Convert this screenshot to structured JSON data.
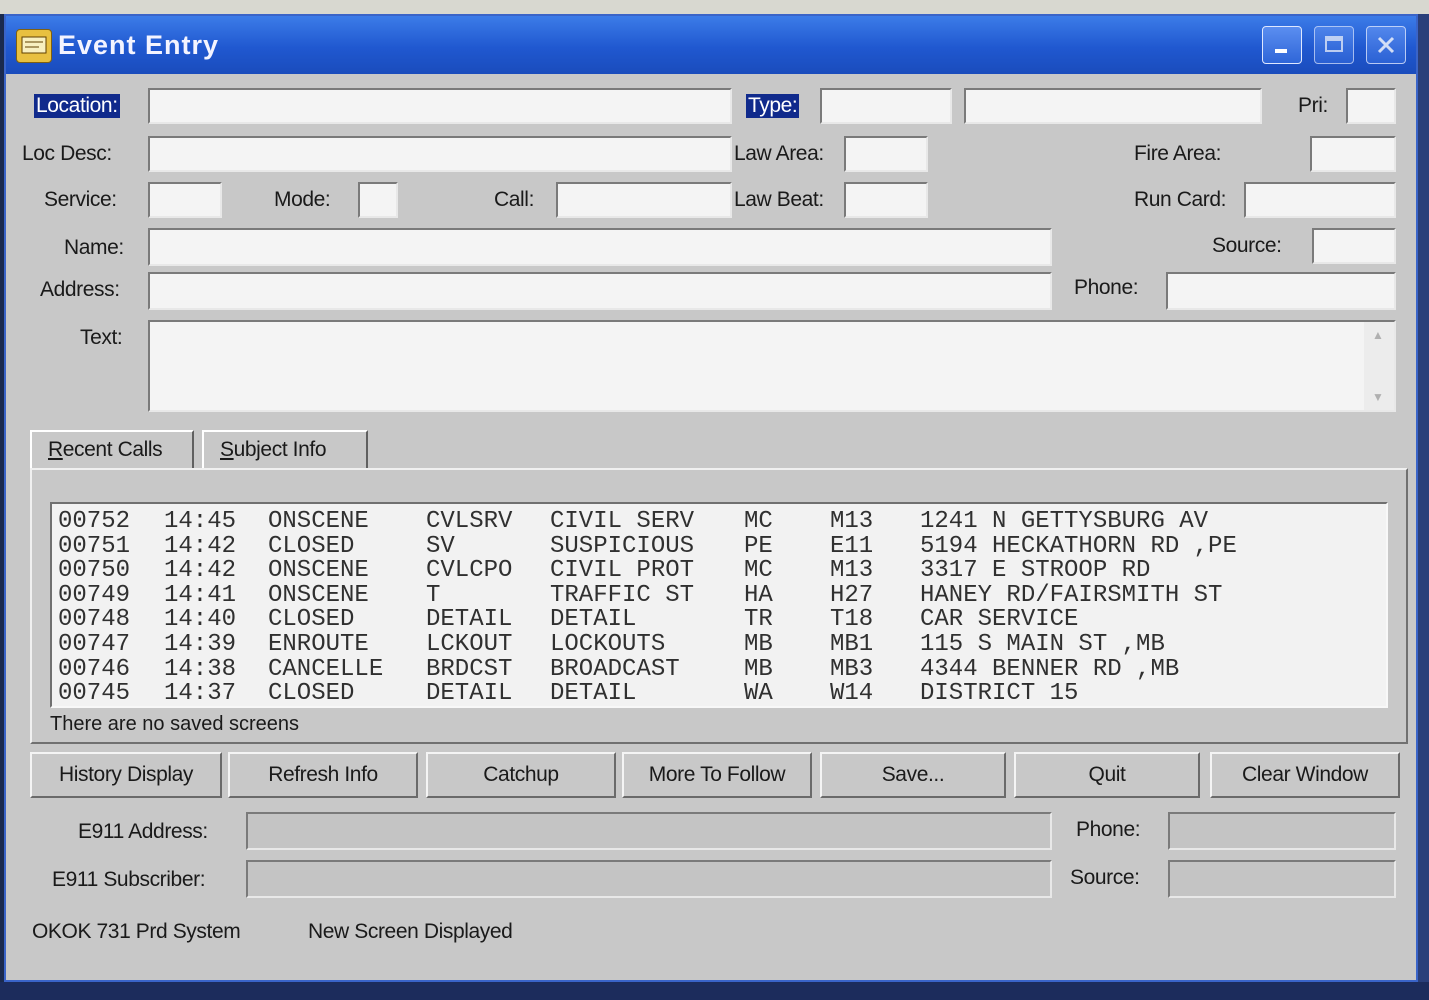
{
  "window": {
    "title": "Event Entry"
  },
  "fields": {
    "location": {
      "label": "Location:",
      "value": ""
    },
    "type": {
      "label": "Type:",
      "value": "",
      "desc": ""
    },
    "pri": {
      "label": "Pri:",
      "value": ""
    },
    "loc_desc": {
      "label": "Loc Desc:",
      "value": ""
    },
    "law_area": {
      "label": "Law Area:",
      "value": ""
    },
    "fire_area": {
      "label": "Fire Area:",
      "value": ""
    },
    "service": {
      "label": "Service:",
      "value": ""
    },
    "mode": {
      "label": "Mode:",
      "value": ""
    },
    "call": {
      "label": "Call:",
      "value": ""
    },
    "law_beat": {
      "label": "Law Beat:",
      "value": ""
    },
    "run_card": {
      "label": "Run Card:",
      "value": ""
    },
    "name": {
      "label": "Name:",
      "value": ""
    },
    "source": {
      "label": "Source:",
      "value": ""
    },
    "address": {
      "label": "Address:",
      "value": ""
    },
    "phone": {
      "label": "Phone:",
      "value": ""
    },
    "text": {
      "label": "Text:",
      "value": ""
    }
  },
  "tabs": [
    {
      "label_first": "R",
      "label_rest": "ecent Calls"
    },
    {
      "label_first": "S",
      "label_rest": "ubject Info"
    }
  ],
  "recent_calls": {
    "rows": [
      {
        "num": "00752",
        "time": "14:45",
        "status": "ONSCENE",
        "code": "CVLSRV",
        "desc": "CIVIL SERV",
        "agency": "MC",
        "unit": "M13",
        "location": "1241 N GETTYSBURG AV"
      },
      {
        "num": "00751",
        "time": "14:42",
        "status": "CLOSED",
        "code": "SV",
        "desc": "SUSPICIOUS",
        "agency": "PE",
        "unit": "E11",
        "location": "5194 HECKATHORN RD ,PE"
      },
      {
        "num": "00750",
        "time": "14:42",
        "status": "ONSCENE",
        "code": "CVLCPO",
        "desc": "CIVIL PROT",
        "agency": "MC",
        "unit": "M13",
        "location": "3317 E STROOP RD"
      },
      {
        "num": "00749",
        "time": "14:41",
        "status": "ONSCENE",
        "code": "T",
        "desc": "TRAFFIC ST",
        "agency": "HA",
        "unit": "H27",
        "location": "HANEY RD/FAIRSMITH ST"
      },
      {
        "num": "00748",
        "time": "14:40",
        "status": "CLOSED",
        "code": "DETAIL",
        "desc": "DETAIL",
        "agency": "TR",
        "unit": "T18",
        "location": "CAR SERVICE"
      },
      {
        "num": "00747",
        "time": "14:39",
        "status": "ENROUTE",
        "code": "LCKOUT",
        "desc": "LOCKOUTS",
        "agency": "MB",
        "unit": "MB1",
        "location": "115 S MAIN ST ,MB"
      },
      {
        "num": "00746",
        "time": "14:38",
        "status": "CANCELLE",
        "code": "BRDCST",
        "desc": "BROADCAST",
        "agency": "MB",
        "unit": "MB3",
        "location": "4344 BENNER RD ,MB"
      },
      {
        "num": "00745",
        "time": "14:37",
        "status": "CLOSED",
        "code": "DETAIL",
        "desc": "DETAIL",
        "agency": "WA",
        "unit": "W14",
        "location": "DISTRICT 15"
      }
    ],
    "status_message": "There are no saved screens"
  },
  "buttons": {
    "history": "History Display",
    "refresh": "Refresh Info",
    "catchup": "Catchup",
    "more": "More To Follow",
    "save": "Save...",
    "quit": "Quit",
    "clear": "Clear Window"
  },
  "e911": {
    "address_label": "E911 Address:",
    "address_value": "",
    "subscriber_label": "E911 Subscriber:",
    "subscriber_value": "",
    "phone_label": "Phone:",
    "phone_value": "",
    "source_label": "Source:",
    "source_value": ""
  },
  "status_bar": {
    "system": "OKOK 731 Prd System",
    "message": "New Screen Displayed"
  }
}
